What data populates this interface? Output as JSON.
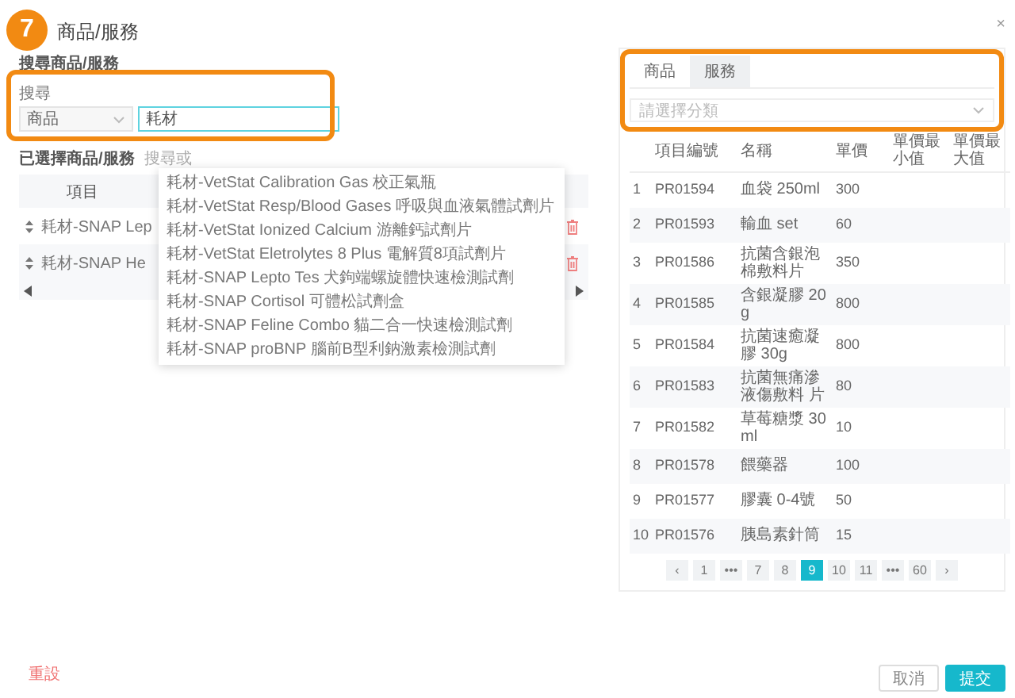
{
  "step_badge": "7",
  "dialog": {
    "title": "商品/服務",
    "close": "×"
  },
  "search_section": {
    "label": "搜尋商品/服務",
    "field_label": "搜尋",
    "category_select": "商品",
    "query": "耗材"
  },
  "suggestions": [
    "耗材-VetStat Calibration Gas 校正氣瓶",
    "耗材-VetStat Resp/Blood Gases 呼吸與血液氣體試劑片",
    "耗材-VetStat Ionized Calcium 游離鈣試劑片",
    "耗材-VetStat Eletrolytes 8 Plus 電解質8項試劑片",
    "耗材-SNAP Lepto Tes 犬鉤端螺旋體快速檢測試劑",
    "耗材-SNAP Cortisol 可體松試劑盒",
    "耗材-SNAP Feline Combo 貓二合一快速檢測試劑",
    "耗材-SNAP proBNP 腦前B型利鈉激素檢測試劑"
  ],
  "selected_section": {
    "label": "已選擇商品/服務",
    "hint": "搜尋或"
  },
  "selected_table": {
    "columns": [
      "項目"
    ],
    "rows": [
      {
        "item": "耗材-SNAP Lep"
      },
      {
        "item": "耗材-SNAP He"
      }
    ]
  },
  "catalog": {
    "tabs": [
      {
        "label": "商品",
        "selected": true
      },
      {
        "label": "服務",
        "selected": false
      }
    ],
    "category_placeholder": "請選擇分類",
    "columns": [
      "項目編號",
      "名稱",
      "單價",
      "單價最小值",
      "單價最大值"
    ],
    "rows": [
      {
        "index": "1",
        "code": "PR01594",
        "name": "血袋 250ml",
        "price": "300"
      },
      {
        "index": "2",
        "code": "PR01593",
        "name": "輸血 set",
        "price": "60"
      },
      {
        "index": "3",
        "code": "PR01586",
        "name": "抗菌含銀泡棉敷料片",
        "price": "350"
      },
      {
        "index": "4",
        "code": "PR01585",
        "name": "含銀凝膠 20g",
        "price": "800"
      },
      {
        "index": "5",
        "code": "PR01584",
        "name": "抗菌速癒凝膠 30g",
        "price": "800"
      },
      {
        "index": "6",
        "code": "PR01583",
        "name": "抗菌無痛滲液傷敷料 片",
        "price": "80"
      },
      {
        "index": "7",
        "code": "PR01582",
        "name": "草莓糖漿 30ml",
        "price": "10"
      },
      {
        "index": "8",
        "code": "PR01578",
        "name": "餵藥器",
        "price": "100"
      },
      {
        "index": "9",
        "code": "PR01577",
        "name": "膠囊 0-4號",
        "price": "50"
      },
      {
        "index": "10",
        "code": "PR01576",
        "name": "胰島素針筒",
        "price": "15"
      }
    ]
  },
  "pagination": {
    "prev": "‹",
    "next": "›",
    "pages": [
      {
        "label": "1",
        "selected": false
      },
      {
        "label": "•••",
        "selected": false
      },
      {
        "label": "7",
        "selected": false
      },
      {
        "label": "8",
        "selected": false
      },
      {
        "label": "9",
        "selected": true
      },
      {
        "label": "10",
        "selected": false
      },
      {
        "label": "11",
        "selected": false
      },
      {
        "label": "•••",
        "selected": false
      },
      {
        "label": "60",
        "selected": false
      }
    ]
  },
  "footer": {
    "reset": "重設",
    "cancel": "取消",
    "submit": "提交"
  }
}
